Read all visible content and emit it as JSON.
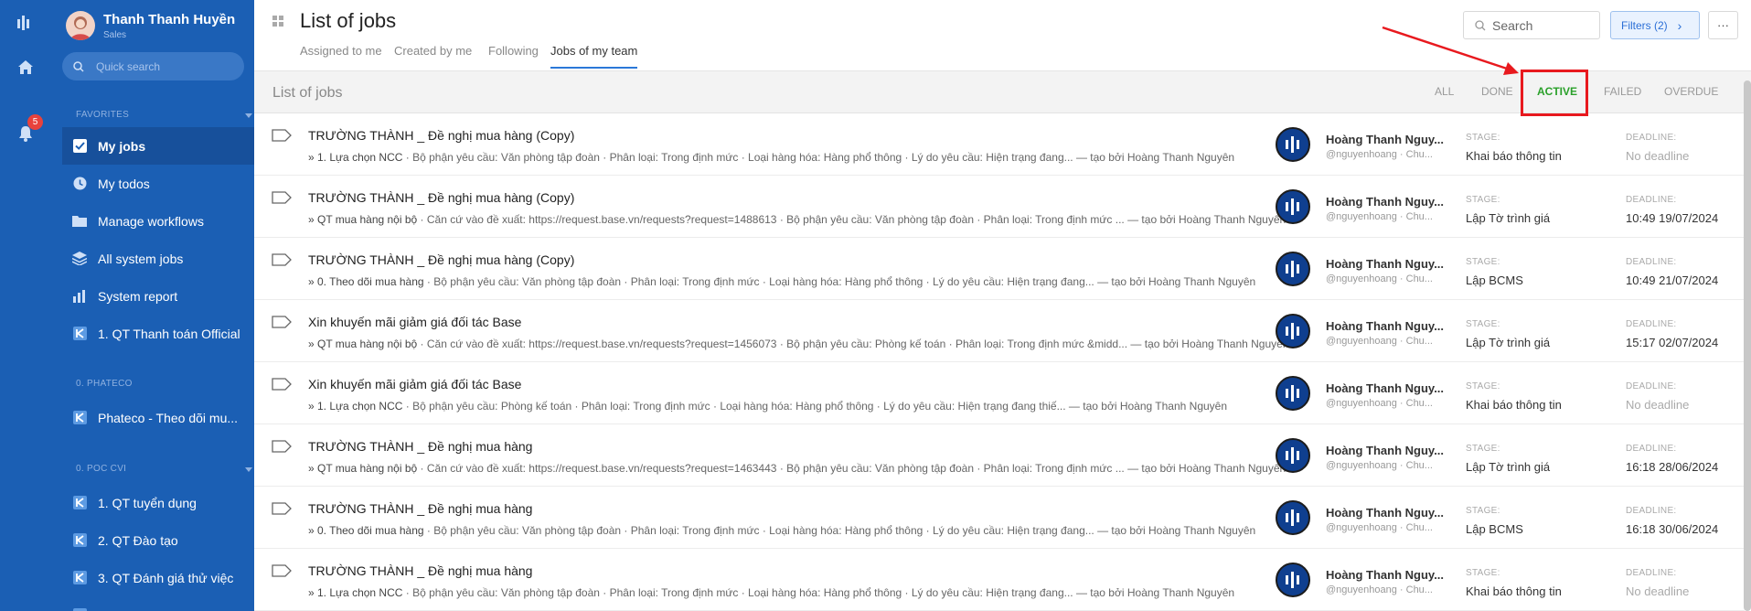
{
  "user": {
    "name": "Thanh Thanh Huyền",
    "role": "Sales"
  },
  "rail": {
    "notification_count": "5"
  },
  "sidebar": {
    "search_placeholder": "Quick search",
    "favorites_label": "FAVORITES",
    "items": [
      {
        "label": "My jobs",
        "icon": "checkbox-icon",
        "active": true
      },
      {
        "label": "My todos",
        "icon": "clock-icon"
      },
      {
        "label": "Manage workflows",
        "icon": "folder-icon"
      },
      {
        "label": "All system jobs",
        "icon": "layers-icon"
      },
      {
        "label": "System report",
        "icon": "bar-chart-icon"
      },
      {
        "label": "1. QT Thanh toán Official",
        "icon": "workflow-icon"
      }
    ],
    "group1_label": "0. PHATECO",
    "group1_items": [
      {
        "label": "Phateco - Theo dõi mu..."
      }
    ],
    "group2_label": "0. POC CVI",
    "group2_items": [
      {
        "label": "1. QT tuyển dụng"
      },
      {
        "label": "2. QT Đào tạo"
      },
      {
        "label": "3. QT Đánh giá thử việc"
      }
    ]
  },
  "header": {
    "title": "List of jobs",
    "tabs": [
      "Assigned to me",
      "Created by me",
      "Following",
      "Jobs of my team"
    ],
    "active_tab": "Jobs of my team",
    "search_placeholder": "Search",
    "filters_label": "Filters (2)",
    "more_label": "···"
  },
  "list": {
    "title": "List of jobs",
    "filter_tabs": [
      "ALL",
      "DONE",
      "ACTIVE",
      "FAILED",
      "OVERDUE"
    ],
    "active_filter": "ACTIVE",
    "stage_label": "STAGE:",
    "deadline_label": "DEADLINE:",
    "rows": [
      {
        "title": "TRƯỜNG THÀNH _ Đề nghị mua hàng (Copy)",
        "step": "» 1. Lựa chọn NCC",
        "details": " · Bộ phận yêu cầu: Văn phòng tập đoàn · Phân loại: Trong định mức · Loại hàng hóa: Hàng phổ thông · Lý do yêu cầu: Hiện trạng đang... — tạo bởi Hoàng Thanh Nguyên",
        "assignee": "Hoàng Thanh Nguy...",
        "handle": "@nguyenhoang · Chu...",
        "stage": "Khai báo thông tin",
        "deadline": "No deadline"
      },
      {
        "title": "TRƯỜNG THÀNH _ Đề nghị mua hàng (Copy)",
        "step": "» QT mua hàng nội bộ",
        "details": " · Căn cứ vào đề xuất: https://request.base.vn/requests?request=1488613 · Bộ phận yêu cầu: Văn phòng tập đoàn · Phân loại: Trong định mức ... — tạo bởi Hoàng Thanh Nguyên",
        "assignee": "Hoàng Thanh Nguy...",
        "handle": "@nguyenhoang · Chu...",
        "stage": "Lập Tờ trình giá",
        "deadline": "10:49 19/07/2024"
      },
      {
        "title": "TRƯỜNG THÀNH _ Đề nghị mua hàng (Copy)",
        "step": "» 0. Theo dõi mua hàng",
        "details": " · Bộ phận yêu cầu: Văn phòng tập đoàn · Phân loại: Trong định mức · Loại hàng hóa: Hàng phổ thông · Lý do yêu cầu: Hiện trạng đang... — tạo bởi Hoàng Thanh Nguyên",
        "assignee": "Hoàng Thanh Nguy...",
        "handle": "@nguyenhoang · Chu...",
        "stage": "Lập BCMS",
        "deadline": "10:49 21/07/2024"
      },
      {
        "title": "Xin khuyến mãi giảm giá đối tác Base",
        "step": "» QT mua hàng nội bộ",
        "details": " · Căn cứ vào đề xuất: https://request.base.vn/requests?request=1456073 · Bộ phận yêu cầu: Phòng kế toán · Phân loại: Trong định mức &midd... — tạo bởi Hoàng Thanh Nguyên",
        "assignee": "Hoàng Thanh Nguy...",
        "handle": "@nguyenhoang · Chu...",
        "stage": "Lập Tờ trình giá",
        "deadline": "15:17 02/07/2024"
      },
      {
        "title": "Xin khuyến mãi giảm giá đối tác Base",
        "step": "» 1. Lựa chọn NCC",
        "details": " · Bộ phận yêu cầu: Phòng kế toán · Phân loại: Trong định mức · Loại hàng hóa: Hàng phổ thông · Lý do yêu cầu: Hiện trạng đang thiế... — tạo bởi Hoàng Thanh Nguyên",
        "assignee": "Hoàng Thanh Nguy...",
        "handle": "@nguyenhoang · Chu...",
        "stage": "Khai báo thông tin",
        "deadline": "No deadline"
      },
      {
        "title": "TRƯỜNG THÀNH _ Đề nghị mua hàng",
        "step": "» QT mua hàng nội bộ",
        "details": " · Căn cứ vào đề xuất: https://request.base.vn/requests?request=1463443 · Bộ phận yêu cầu: Văn phòng tập đoàn · Phân loại: Trong định mức ... — tạo bởi Hoàng Thanh Nguyên",
        "assignee": "Hoàng Thanh Nguy...",
        "handle": "@nguyenhoang · Chu...",
        "stage": "Lập Tờ trình giá",
        "deadline": "16:18 28/06/2024"
      },
      {
        "title": "TRƯỜNG THÀNH _ Đề nghị mua hàng",
        "step": "» 0. Theo dõi mua hàng",
        "details": " · Bộ phận yêu cầu: Văn phòng tập đoàn · Phân loại: Trong định mức · Loại hàng hóa: Hàng phổ thông · Lý do yêu cầu: Hiện trạng đang... — tạo bởi Hoàng Thanh Nguyên",
        "assignee": "Hoàng Thanh Nguy...",
        "handle": "@nguyenhoang · Chu...",
        "stage": "Lập BCMS",
        "deadline": "16:18 30/06/2024"
      },
      {
        "title": "TRƯỜNG THÀNH _ Đề nghị mua hàng",
        "step": "» 1. Lựa chọn NCC",
        "details": " · Bộ phận yêu cầu: Văn phòng tập đoàn · Phân loại: Trong định mức · Loại hàng hóa: Hàng phổ thông · Lý do yêu cầu: Hiện trạng đang... — tạo bởi Hoàng Thanh Nguyên",
        "assignee": "Hoàng Thanh Nguy...",
        "handle": "@nguyenhoang · Chu...",
        "stage": "Khai báo thông tin",
        "deadline": "No deadline"
      }
    ]
  },
  "colors": {
    "sidebar_bg": "#1b5fb4",
    "active_filter": "#2aa02a",
    "highlight": "#e8191e",
    "link": "#2b6fd6"
  }
}
